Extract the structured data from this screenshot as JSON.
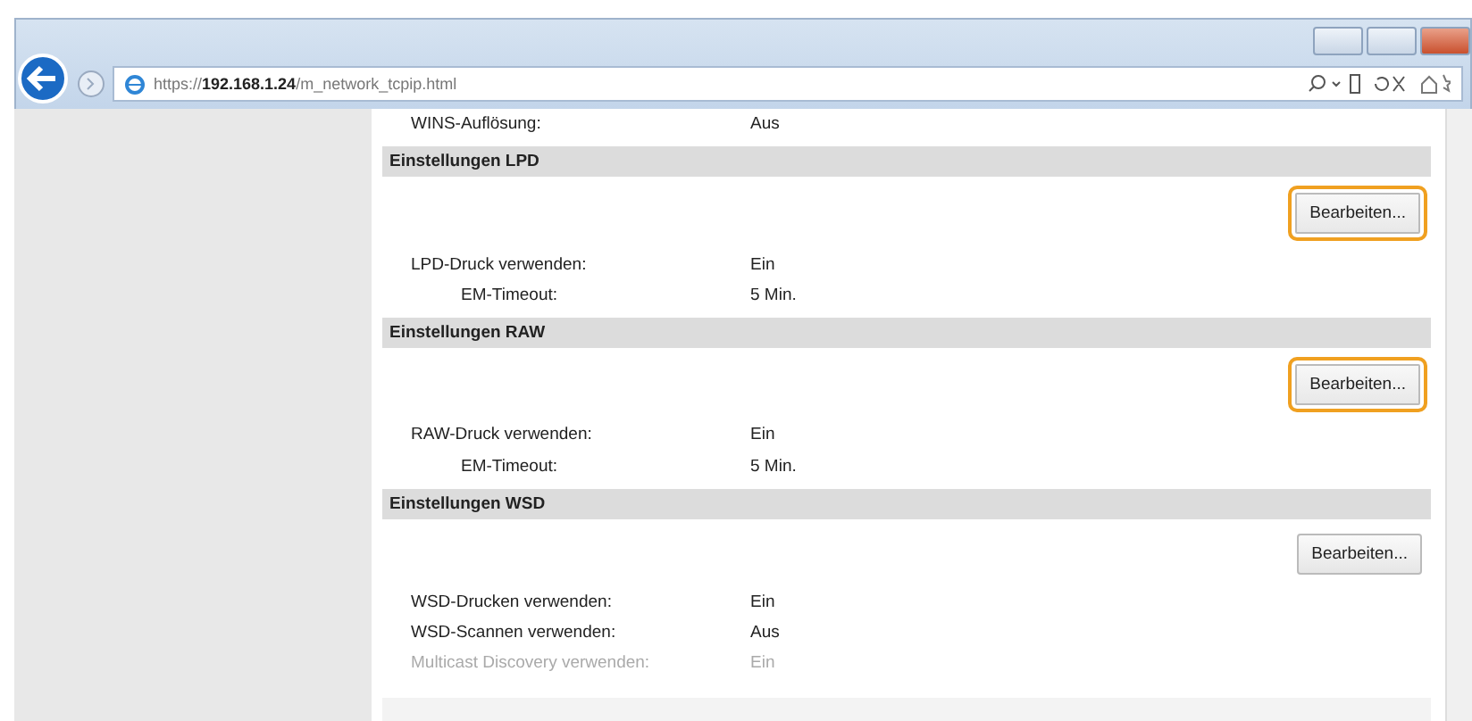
{
  "browser": {
    "url": "https://**192.168.1.24**/m_network_tcpip.html"
  },
  "top_rows": [
    {
      "label": "WINS-Auflösung:",
      "value": "Aus",
      "disabled": false,
      "children": []
    }
  ],
  "sections": [
    {
      "title": "Einstellungen LPD",
      "button": {
        "label": "Bearbeiten...",
        "highlighted": true
      },
      "rows": [
        {
          "label": "LPD-Druck verwenden:",
          "value": "Ein",
          "disabled": false,
          "children": [
            {
              "label": "EM-Timeout:",
              "value": "5 Min.",
              "disabled": false
            }
          ]
        }
      ]
    },
    {
      "title": "Einstellungen RAW",
      "button": {
        "label": "Bearbeiten...",
        "highlighted": true
      },
      "rows": [
        {
          "label": "RAW-Druck verwenden:",
          "value": "Ein",
          "disabled": false,
          "children": [
            {
              "label": "EM-Timeout:",
              "value": "5 Min.",
              "disabled": false
            }
          ]
        }
      ]
    },
    {
      "title": "Einstellungen WSD",
      "button": {
        "label": "Bearbeiten...",
        "highlighted": false
      },
      "rows": [
        {
          "label": "WSD-Drucken verwenden:",
          "value": "Ein",
          "disabled": false,
          "children": []
        },
        {
          "label": "WSD-Scannen verwenden:",
          "value": "Aus",
          "disabled": false,
          "children": []
        },
        {
          "label": "Multicast Discovery verwenden:",
          "value": "Ein",
          "disabled": true,
          "children": []
        }
      ]
    }
  ]
}
